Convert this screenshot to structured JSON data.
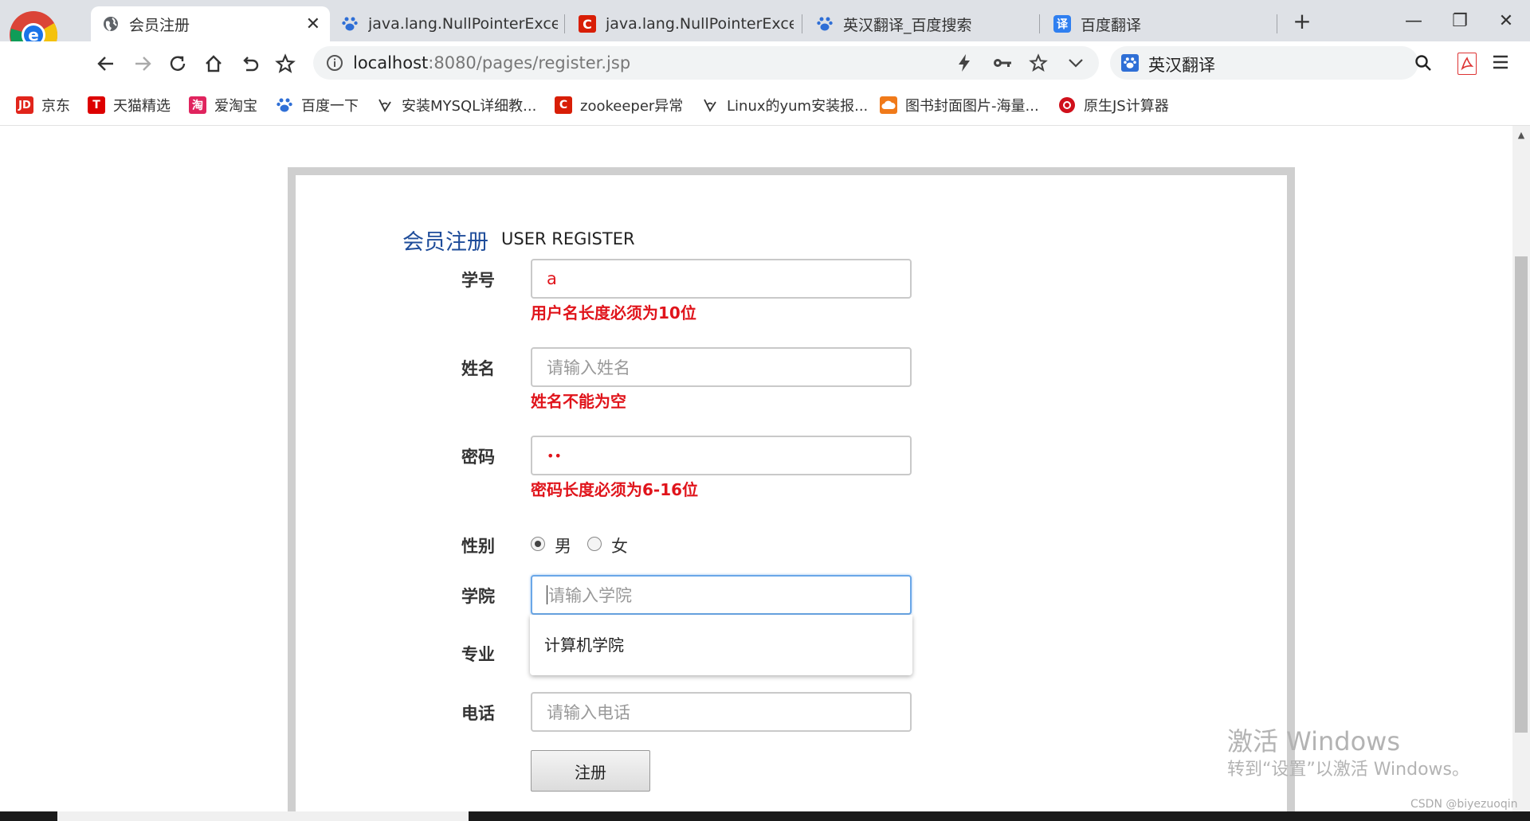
{
  "tabs": [
    {
      "label": "会员注册",
      "icon": "globe-icon",
      "active": true
    },
    {
      "label": "java.lang.NullPointerExcep",
      "icon": "baidu-paw-icon"
    },
    {
      "label": "java.lang.NullPointerExcep",
      "icon": "csdn-c-icon"
    },
    {
      "label": "英汉翻译_百度搜索",
      "icon": "baidu-paw-icon"
    },
    {
      "label": "百度翻译",
      "icon": "baidu-translate-icon",
      "badge": "译"
    }
  ],
  "window_controls": {
    "new_tab": "+",
    "minimize": "—",
    "restore": "❐",
    "close": "✕"
  },
  "toolbar": {
    "url_host": "localhost",
    "url_rest": ":8080/pages/register.jsp",
    "search_text": "英汉翻译"
  },
  "bookmarks": [
    {
      "label": "京东",
      "icon": "jd-icon",
      "badge": "JD",
      "color": "#e1251b"
    },
    {
      "label": "天猫精选",
      "icon": "tmall-icon",
      "badge": "T",
      "color": "#e00"
    },
    {
      "label": "爱淘宝",
      "icon": "taobao-icon",
      "badge": "淘",
      "color": "#e0245e"
    },
    {
      "label": "百度一下",
      "icon": "baidu-paw-icon",
      "color": "#2f6fd6"
    },
    {
      "label": "安装MYSQL详细教...",
      "icon": "pen-icon"
    },
    {
      "label": "zookeeper异常",
      "icon": "csdn-c-icon",
      "badge": "C",
      "color": "#d81e06"
    },
    {
      "label": "Linux的yum安装报...",
      "icon": "pen-icon"
    },
    {
      "label": "图书封面图片-海量...",
      "icon": "cloud-icon",
      "color": "#f07a1a"
    },
    {
      "label": "原生JS计算器",
      "icon": "red-circle-icon",
      "color": "#d0101b"
    }
  ],
  "form": {
    "title_cn": "会员注册",
    "title_en": "USER REGISTER",
    "labels": {
      "student_id": "学号",
      "name": "姓名",
      "password": "密码",
      "gender": "性别",
      "college": "学院",
      "major": "专业",
      "phone": "电话"
    },
    "student_id_value": "a",
    "student_id_error": "用户名长度必须为10位",
    "name_placeholder": "请输入姓名",
    "name_error": "姓名不能为空",
    "password_value": "••",
    "password_error": "密码长度必须为6-16位",
    "gender_options": [
      "男",
      "女"
    ],
    "gender_selected": "男",
    "college_placeholder": "请输入学院",
    "college_suggestion": "计算机学院",
    "phone_placeholder": "请输入电话",
    "submit_label": "注册"
  },
  "watermark": {
    "line1": "激活 Windows",
    "line2": "转到“设置”以激活 Windows。"
  },
  "credit": "CSDN @biyezuoqin",
  "colors": {
    "error": "#e0141b",
    "title": "#1e4c9a",
    "focus_border": "#6aa7e8"
  }
}
